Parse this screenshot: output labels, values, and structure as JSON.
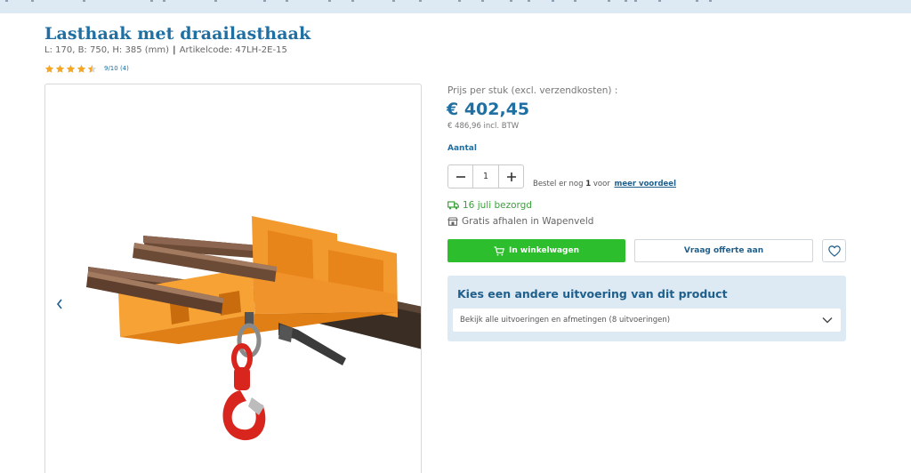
{
  "product": {
    "title": "Lasthaak met draailasthaak",
    "dimensions": "L: 170, B: 750, H: 385 (mm)",
    "article_code": "Artikelcode: 47LH-2E-15",
    "rating_text": "9/10 (4)",
    "rating_value": 4.5,
    "rating_max": 5
  },
  "gallery": {
    "prev_icon": "chevron-left-icon"
  },
  "pricing": {
    "label": "Prijs per stuk (excl. verzendkosten) :",
    "price": "€ 402,45",
    "price_incl": "€ 486,96 incl. BTW"
  },
  "quantity": {
    "label": "Aantal",
    "value": "1"
  },
  "order_more": {
    "prefix": "Bestel er nog",
    "count": "1",
    "suffix": "voor",
    "link": "meer voordeel"
  },
  "delivery": {
    "date_text": "16 juli bezorgd",
    "pickup_text": "Gratis afhalen in Wapenveld"
  },
  "actions": {
    "cart_label": "In winkelwagen",
    "quote_label": "Vraag offerte aan"
  },
  "variants": {
    "title": "Kies een andere uitvoering van dit product",
    "select_text": "Bekijk alle uitvoeringen en afmetingen (8 uitvoeringen)"
  },
  "colors": {
    "brand_blue": "#1f6fa3",
    "cart_green": "#2dbe2d",
    "delivery_green": "#3aa23a",
    "star_orange": "#f5a623",
    "panel_blue": "#dde9f3"
  }
}
